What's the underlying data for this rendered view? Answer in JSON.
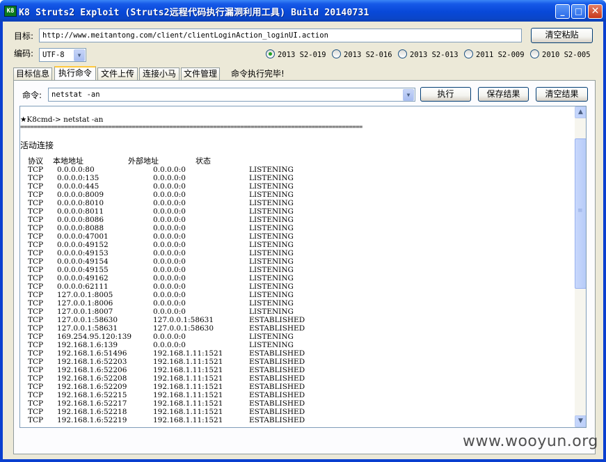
{
  "window": {
    "title": "K8 Struts2 Exploit (Struts2远程代码执行漏洞利用工具)  Build 20140731",
    "icon_text": "K8",
    "min_glyph": "_",
    "max_glyph": "□",
    "close_glyph": "✕"
  },
  "target": {
    "label": "目标:",
    "url": "http://www.meitantong.com/client/clientLoginAction_loginUI.action",
    "clear_paste_label": "清空粘贴"
  },
  "encoding": {
    "label": "编码:",
    "value": "UTF-8",
    "arrow": "▼"
  },
  "vulns": [
    {
      "label": "2013 S2-019",
      "selected": true
    },
    {
      "label": "2013 S2-016",
      "selected": false
    },
    {
      "label": "2013 S2-013",
      "selected": false
    },
    {
      "label": "2011 S2-009",
      "selected": false
    },
    {
      "label": "2010 S2-005",
      "selected": false
    }
  ],
  "tabs": [
    {
      "label": "目标信息"
    },
    {
      "label": "执行命令",
      "active": true
    },
    {
      "label": "文件上传"
    },
    {
      "label": "连接小马"
    },
    {
      "label": "文件管理"
    }
  ],
  "status_text": "命令执行完毕!",
  "command": {
    "label": "命令:",
    "value": "netstat -an",
    "arrow": "▼",
    "execute_label": "执行",
    "save_label": "保存结果",
    "clear_label": "清空结果"
  },
  "output": {
    "prompt_line": "★K8cmd-> netstat -an",
    "separator": "=====================================================================================================",
    "section_title": "活动连接",
    "headers": [
      "协议",
      "本地地址",
      "外部地址",
      "状态"
    ],
    "rows": [
      [
        "TCP",
        "0.0.0.0:80",
        "0.0.0.0:0",
        "LISTENING"
      ],
      [
        "TCP",
        "0.0.0.0:135",
        "0.0.0.0:0",
        "LISTENING"
      ],
      [
        "TCP",
        "0.0.0.0:445",
        "0.0.0.0:0",
        "LISTENING"
      ],
      [
        "TCP",
        "0.0.0.0:8009",
        "0.0.0.0:0",
        "LISTENING"
      ],
      [
        "TCP",
        "0.0.0.0:8010",
        "0.0.0.0:0",
        "LISTENING"
      ],
      [
        "TCP",
        "0.0.0.0:8011",
        "0.0.0.0:0",
        "LISTENING"
      ],
      [
        "TCP",
        "0.0.0.0:8086",
        "0.0.0.0:0",
        "LISTENING"
      ],
      [
        "TCP",
        "0.0.0.0:8088",
        "0.0.0.0:0",
        "LISTENING"
      ],
      [
        "TCP",
        "0.0.0.0:47001",
        "0.0.0.0:0",
        "LISTENING"
      ],
      [
        "TCP",
        "0.0.0.0:49152",
        "0.0.0.0:0",
        "LISTENING"
      ],
      [
        "TCP",
        "0.0.0.0:49153",
        "0.0.0.0:0",
        "LISTENING"
      ],
      [
        "TCP",
        "0.0.0.0:49154",
        "0.0.0.0:0",
        "LISTENING"
      ],
      [
        "TCP",
        "0.0.0.0:49155",
        "0.0.0.0:0",
        "LISTENING"
      ],
      [
        "TCP",
        "0.0.0.0:49162",
        "0.0.0.0:0",
        "LISTENING"
      ],
      [
        "TCP",
        "0.0.0.0:62111",
        "0.0.0.0:0",
        "LISTENING"
      ],
      [
        "TCP",
        "127.0.0.1:8005",
        "0.0.0.0:0",
        "LISTENING"
      ],
      [
        "TCP",
        "127.0.0.1:8006",
        "0.0.0.0:0",
        "LISTENING"
      ],
      [
        "TCP",
        "127.0.0.1:8007",
        "0.0.0.0:0",
        "LISTENING"
      ],
      [
        "TCP",
        "127.0.0.1:58630",
        "127.0.0.1:58631",
        "ESTABLISHED"
      ],
      [
        "TCP",
        "127.0.0.1:58631",
        "127.0.0.1:58630",
        "ESTABLISHED"
      ],
      [
        "TCP",
        "169.254.95.120:139",
        "0.0.0.0:0",
        "LISTENING"
      ],
      [
        "TCP",
        "192.168.1.6:139",
        "0.0.0.0:0",
        "LISTENING"
      ],
      [
        "TCP",
        "192.168.1.6:51496",
        "192.168.1.11:1521",
        "ESTABLISHED"
      ],
      [
        "TCP",
        "192.168.1.6:52203",
        "192.168.1.11:1521",
        "ESTABLISHED"
      ],
      [
        "TCP",
        "192.168.1.6:52206",
        "192.168.1.11:1521",
        "ESTABLISHED"
      ],
      [
        "TCP",
        "192.168.1.6:52208",
        "192.168.1.11:1521",
        "ESTABLISHED"
      ],
      [
        "TCP",
        "192.168.1.6:52209",
        "192.168.1.11:1521",
        "ESTABLISHED"
      ],
      [
        "TCP",
        "192.168.1.6:52215",
        "192.168.1.11:1521",
        "ESTABLISHED"
      ],
      [
        "TCP",
        "192.168.1.6:52217",
        "192.168.1.11:1521",
        "ESTABLISHED"
      ],
      [
        "TCP",
        "192.168.1.6:52218",
        "192.168.1.11:1521",
        "ESTABLISHED"
      ],
      [
        "TCP",
        "192.168.1.6:52219",
        "192.168.1.11:1521",
        "ESTABLISHED"
      ]
    ]
  },
  "scrollbar": {
    "up": "▲",
    "down": "▼",
    "grip": "≡"
  },
  "watermark": "www.wooyun.org"
}
